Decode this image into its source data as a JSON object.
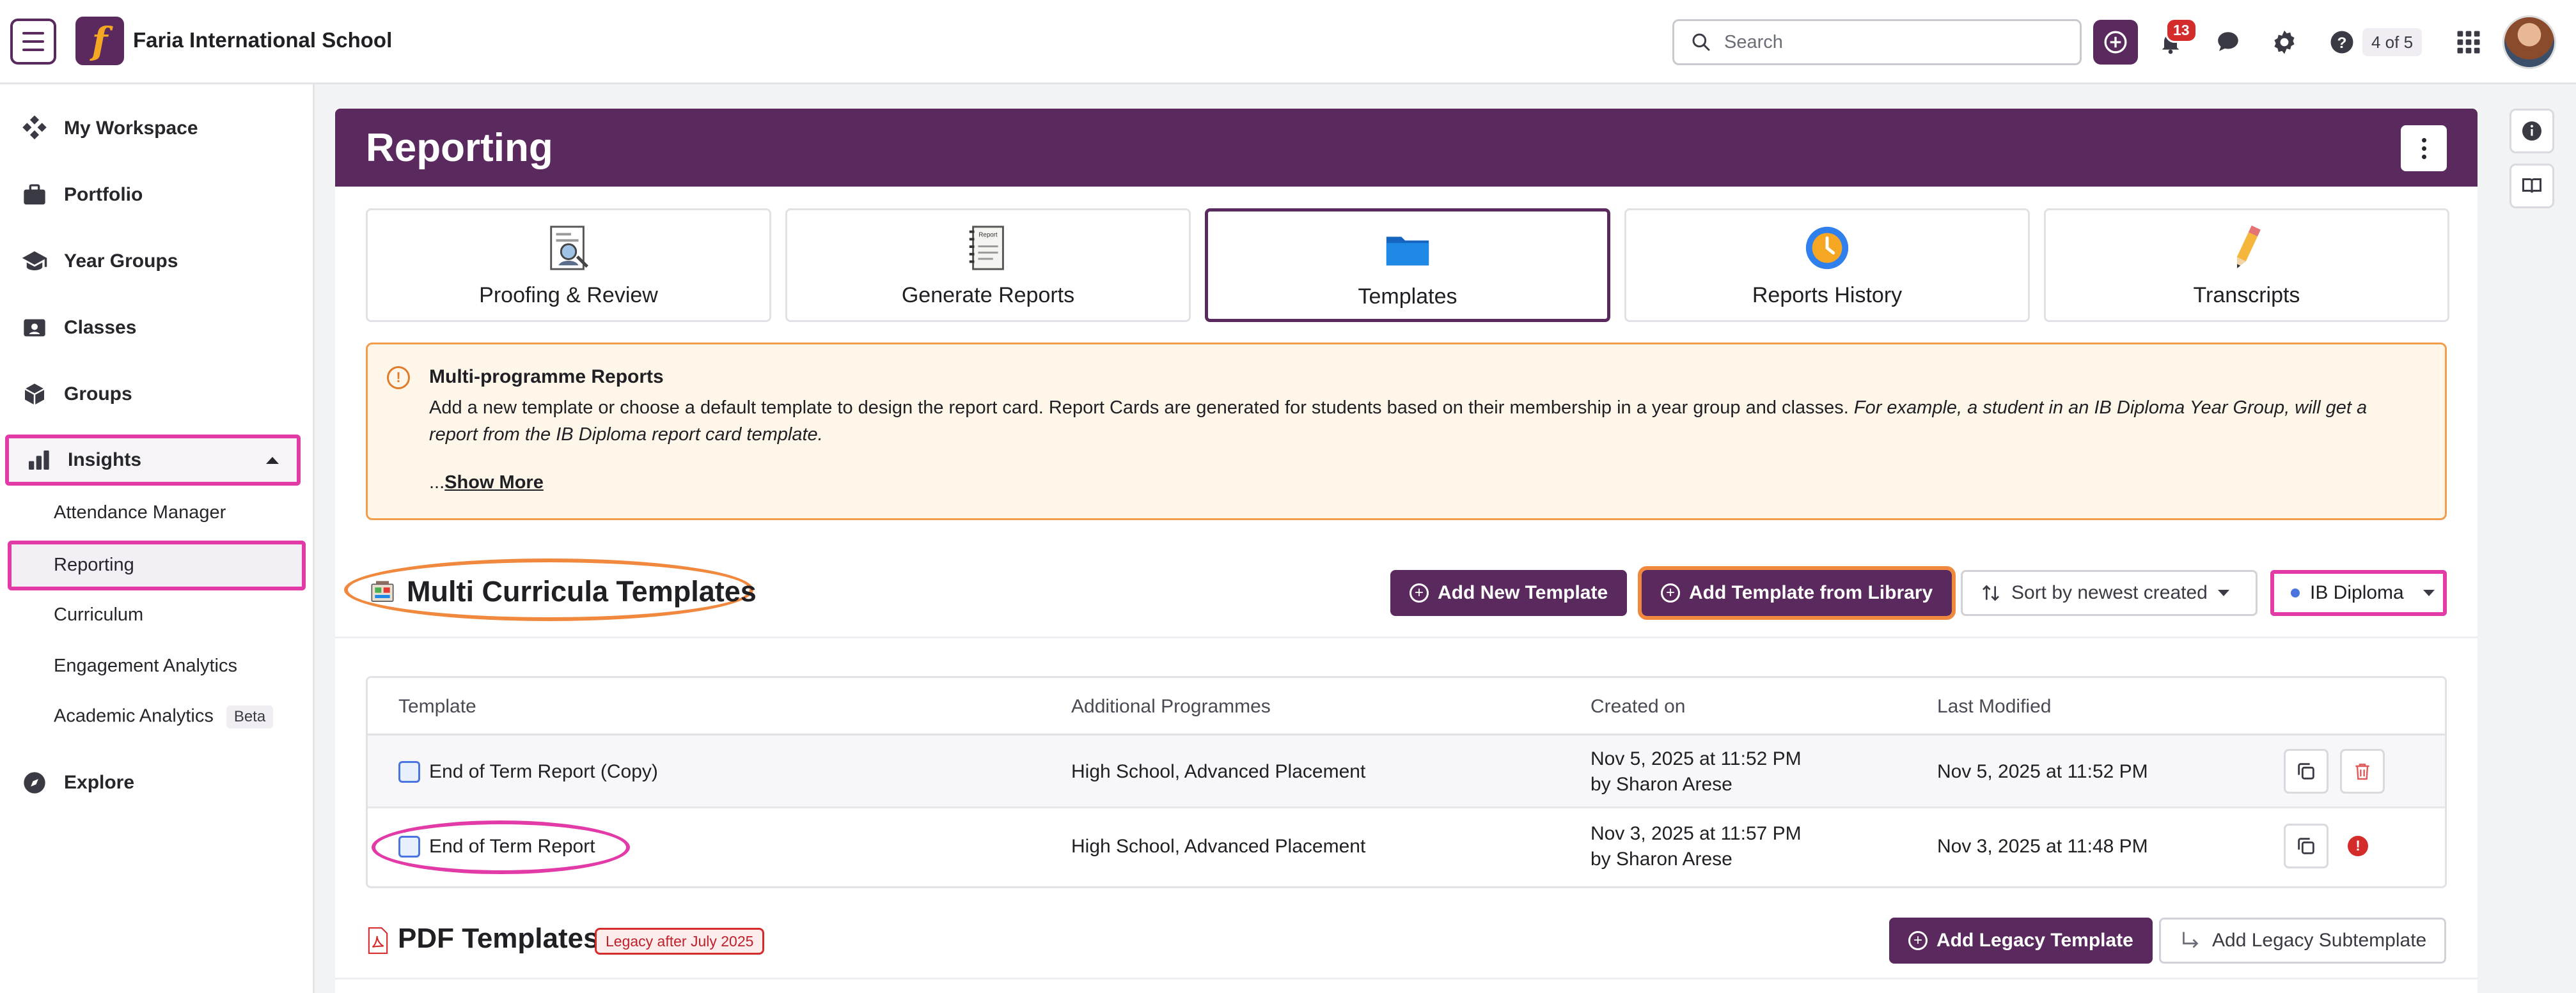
{
  "topbar": {
    "school_name": "Faria International School",
    "logo_letter": "f",
    "search_placeholder": "Search",
    "notification_count": "13",
    "step_indicator": "4 of 5"
  },
  "sidebar": {
    "items": [
      {
        "label": "My Workspace",
        "icon": "workspace-icon"
      },
      {
        "label": "Portfolio",
        "icon": "portfolio-icon"
      },
      {
        "label": "Year Groups",
        "icon": "graduation-cap-icon"
      },
      {
        "label": "Classes",
        "icon": "classes-icon"
      },
      {
        "label": "Groups",
        "icon": "cube-icon"
      },
      {
        "label": "Insights",
        "icon": "bar-chart-icon"
      },
      {
        "label": "Explore",
        "icon": "compass-icon"
      }
    ],
    "sub_items": [
      "Attendance Manager",
      "Reporting",
      "Curriculum",
      "Engagement Analytics",
      "Academic Analytics"
    ],
    "beta_label": "Beta"
  },
  "page": {
    "title": "Reporting",
    "tabs": [
      {
        "label": "Proofing & Review"
      },
      {
        "label": "Generate Reports"
      },
      {
        "label": "Templates"
      },
      {
        "label": "Reports History"
      },
      {
        "label": "Transcripts"
      }
    ],
    "notice": {
      "title": "Multi-programme Reports",
      "body": "Add a new template or choose a default template to design the report card. Report Cards are generated for students based on their membership in a year group and classes.",
      "example": "For example, a student in an IB Diploma Year Group, will get a report from the IB Diploma report card template.",
      "ellipsis": "...",
      "show_more": "Show More"
    },
    "multi": {
      "title": "Multi Curricula Templates",
      "add_new": "Add New Template",
      "add_library": "Add Template from Library",
      "sort_label": "Sort by newest created",
      "programme": "IB Diploma"
    },
    "table": {
      "headers": [
        "Template",
        "Additional Programmes",
        "Created on",
        "Last Modified"
      ],
      "rows": [
        {
          "template": "End of Term Report (Copy)",
          "programmes": "High School, Advanced Placement",
          "created": "Nov 5, 2025 at 11:52 PM",
          "created_by": "by Sharon Arese",
          "modified": "Nov 5, 2025 at 11:52 PM"
        },
        {
          "template": "End of Term Report",
          "programmes": "High School, Advanced Placement",
          "created": "Nov 3, 2025 at 11:57 PM",
          "created_by": "by Sharon Arese",
          "modified": "Nov 3, 2025 at 11:48 PM"
        }
      ]
    },
    "pdf": {
      "title": "PDF Templates",
      "badge": "Legacy after July 2025",
      "add_legacy": "Add Legacy Template",
      "add_sub": "Add Legacy Subtemplate"
    }
  },
  "colors": {
    "brand": "#5a2a5e",
    "highlight_pink": "#e23aa6",
    "highlight_orange": "#f0883e",
    "error": "#d42b2b"
  }
}
